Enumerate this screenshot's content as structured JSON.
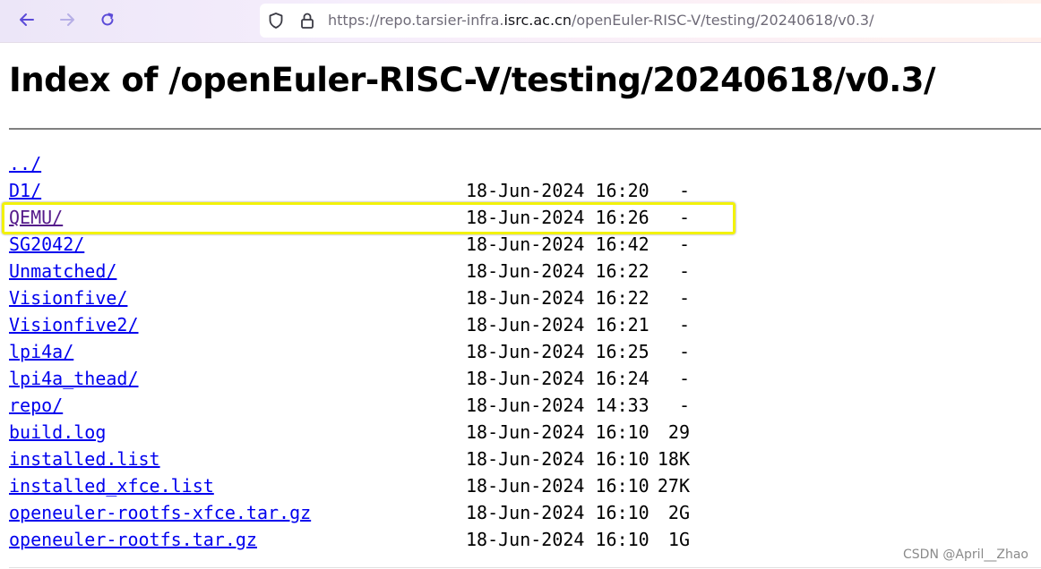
{
  "browser": {
    "url_prefix": "https://repo.tarsier-infra.",
    "url_domain": "isrc.ac.cn",
    "url_path": "/openEuler-RISC-V/testing/20240618/v0.3/",
    "icons": [
      "back-arrow-icon",
      "forward-arrow-icon",
      "reload-icon",
      "shield-icon",
      "lock-icon"
    ]
  },
  "page": {
    "title": "Index of /openEuler-RISC-V/testing/20240618/v0.3/"
  },
  "listing": [
    {
      "name": "../",
      "date": "",
      "size": ""
    },
    {
      "name": "D1/",
      "date": "18-Jun-2024 16:20",
      "size": "-"
    },
    {
      "name": "QEMU/",
      "date": "18-Jun-2024 16:26",
      "size": "-"
    },
    {
      "name": "SG2042/",
      "date": "18-Jun-2024 16:42",
      "size": "-"
    },
    {
      "name": "Unmatched/",
      "date": "18-Jun-2024 16:22",
      "size": "-"
    },
    {
      "name": "Visionfive/",
      "date": "18-Jun-2024 16:22",
      "size": "-"
    },
    {
      "name": "Visionfive2/",
      "date": "18-Jun-2024 16:21",
      "size": "-"
    },
    {
      "name": "lpi4a/",
      "date": "18-Jun-2024 16:25",
      "size": "-"
    },
    {
      "name": "lpi4a_thead/",
      "date": "18-Jun-2024 16:24",
      "size": "-"
    },
    {
      "name": "repo/",
      "date": "18-Jun-2024 14:33",
      "size": "-"
    },
    {
      "name": "build.log",
      "date": "18-Jun-2024 16:10",
      "size": "29"
    },
    {
      "name": "installed.list",
      "date": "18-Jun-2024 16:10",
      "size": "18K"
    },
    {
      "name": "installed_xfce.list",
      "date": "18-Jun-2024 16:10",
      "size": "27K"
    },
    {
      "name": "openeuler-rootfs-xfce.tar.gz",
      "date": "18-Jun-2024 16:10",
      "size": "2G"
    },
    {
      "name": "openeuler-rootfs.tar.gz",
      "date": "18-Jun-2024 16:10",
      "size": "1G"
    }
  ],
  "watermark": "CSDN @April__Zhao",
  "colors": {
    "link": "#0000ee",
    "visited_link": "#551a8b",
    "highlight_border": "#f2f20a",
    "toolbar_accent": "#6b4fd8"
  }
}
